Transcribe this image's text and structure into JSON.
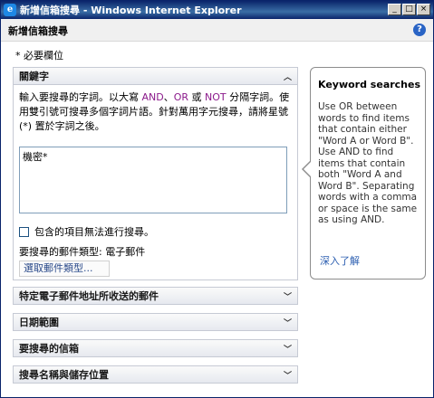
{
  "window": {
    "title": "新增信箱搜尋 - Windows Internet Explorer",
    "icon_name": "ie-icon",
    "buttons": {
      "minimize": "_",
      "maximize": "□",
      "close": "×"
    }
  },
  "header": {
    "title": "新增信箱搜尋",
    "help_icon": "?"
  },
  "required_note": "* 必要欄位",
  "sections": {
    "keywords": {
      "title": "關鍵字",
      "instructions_1": "輸入要搜尋的字詞。以大寫",
      "and_kw": "AND",
      "sep_1": "、",
      "or_kw": "OR",
      "sep_2": " 或 ",
      "not_kw": "NOT",
      "instructions_2": " 分隔字詞。使用雙引號可搜尋多個字詞片語。針對萬用字元搜尋，請將星號 (*) 置於字詞之後。",
      "keyword_value": "機密*",
      "checkbox_label": "包含的項目無法進行搜尋。",
      "mail_type_label": "要搜尋的郵件類型:",
      "mail_type_value": "電子郵件",
      "pick_button": "選取郵件類型..."
    },
    "collapsed": [
      "特定電子郵件地址所收送的郵件",
      "日期範圍",
      "要搜尋的信箱",
      "搜尋名稱與儲存位置"
    ]
  },
  "callout": {
    "title": "Keyword searches",
    "text": "Use OR between words to find items that contain either \"Word A or Word B\". Use AND to find items that contain both \"Word A and Word B\". Separating words with a comma or space is the same as using AND.",
    "link": "深入了解"
  },
  "colors": {
    "titlebar": "#0a246a",
    "operator": "#8b1a8b",
    "link": "#2a5db0"
  }
}
